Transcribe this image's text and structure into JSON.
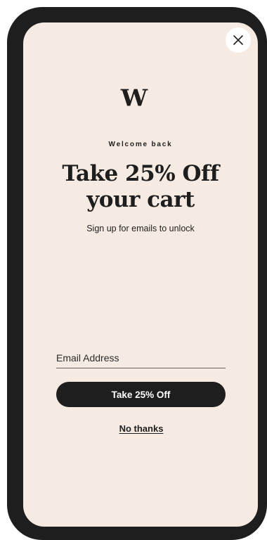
{
  "modal": {
    "logo_text": "W",
    "eyebrow": "Welcome back",
    "headline_line1": "Take 25% Off",
    "headline_line2": "your cart",
    "subtitle": "Sign up for emails to unlock",
    "email_placeholder": "Email Address",
    "email_value": "",
    "cta_label": "Take 25% Off",
    "dismiss_label": "No thanks"
  },
  "icons": {
    "close": "close-icon",
    "logo": "brand-logo"
  },
  "colors": {
    "modal_background": "#f6ebe2",
    "frame": "#1e1e1e",
    "primary_text": "#1e1e1e",
    "button_background": "#1e1e1e",
    "button_text": "#ffffff"
  }
}
